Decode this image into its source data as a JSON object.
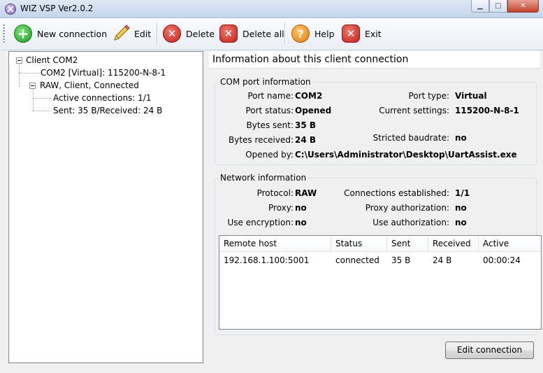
{
  "window": {
    "title": "WIZ VSP Ver2.0.2"
  },
  "toolbar": {
    "new_connection": "New connection",
    "edit": "Edit",
    "delete": "Delete",
    "delete_all": "Delete all",
    "help": "Help",
    "exit": "Exit"
  },
  "tree": {
    "root": "Client COM2",
    "com_node": "COM2 [Virtual]: 115200-N-8-1",
    "raw_node": "RAW, Client, Connected",
    "active_conn": "Active connections: 1/1",
    "traffic": "Sent: 35 B/Received: 24 B"
  },
  "info": {
    "header": "Information about this client connection",
    "com": {
      "title": "COM port information",
      "port_name_label": "Port name:",
      "port_name": "COM2",
      "port_type_label": "Port type:",
      "port_type": "Virtual",
      "port_status_label": "Port status:",
      "port_status": "Opened",
      "current_settings_label": "Current settings:",
      "current_settings": "115200-N-8-1",
      "bytes_sent_label": "Bytes sent:",
      "bytes_sent": "35 B",
      "bytes_received_label": "Bytes received:",
      "bytes_received": "24 B",
      "stricted_baud_label": "Stricted baudrate:",
      "stricted_baud": "no",
      "opened_by_label": "Opened by:",
      "opened_by": "C:\\Users\\Administrator\\Desktop\\UartAssist.exe"
    },
    "net": {
      "title": "Network information",
      "protocol_label": "Protocol:",
      "protocol": "RAW",
      "conn_est_label": "Connections established:",
      "conn_est": "1/1",
      "proxy_label": "Proxy:",
      "proxy": "no",
      "proxy_auth_label": "Proxy authorization:",
      "proxy_auth": "no",
      "use_enc_label": "Use encryption:",
      "use_enc": "no",
      "use_auth_label": "Use authorization:",
      "use_auth": "no"
    },
    "table": {
      "headers": [
        "Remote host",
        "Status",
        "Sent",
        "Received",
        "Active"
      ],
      "rows": [
        [
          "192.168.1.100:5001",
          "connected",
          "35 B",
          "24 B",
          "00:00:24"
        ]
      ]
    },
    "edit_button": "Edit connection"
  }
}
